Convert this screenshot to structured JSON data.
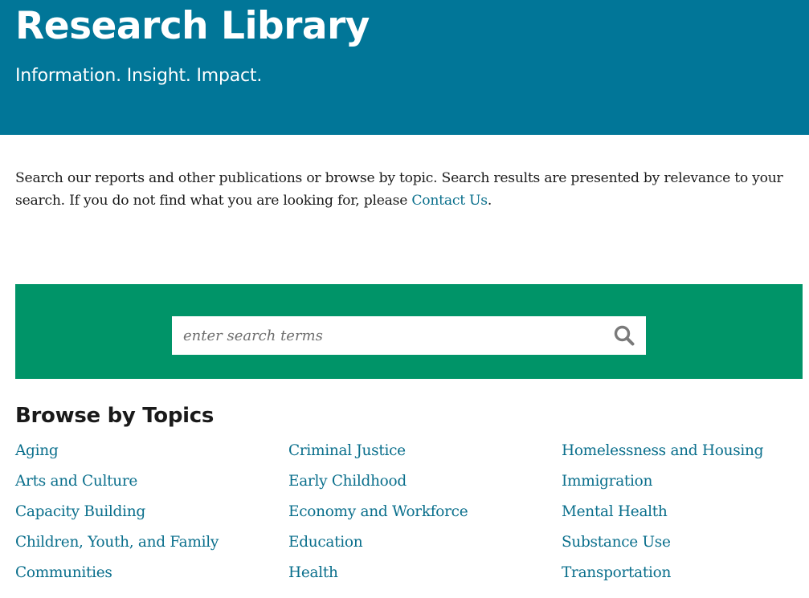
{
  "header": {
    "title": "Research Library",
    "tagline": "Information. Insight. Impact."
  },
  "intro": {
    "text": "Search our reports and other publications or browse by topic. Search results are presented by relevance to your search. If you do not find what you are looking for, please ",
    "link_text": "Contact Us",
    "trailing": "."
  },
  "search": {
    "placeholder": "enter search terms",
    "value": "",
    "button_icon": "search-icon"
  },
  "browse": {
    "title": "Browse by Topics",
    "columns": [
      [
        "Aging",
        "Arts and Culture",
        "Capacity Building",
        "Children, Youth, and Family",
        "Communities"
      ],
      [
        "Criminal Justice",
        "Early Childhood",
        "Economy and Workforce",
        "Education",
        "Health"
      ],
      [
        "Homelessness and Housing",
        "Immigration",
        "Mental Health",
        "Substance Use",
        "Transportation"
      ]
    ]
  },
  "colors": {
    "header_bg": "#017698",
    "search_band_bg": "#009468",
    "link": "#0a6f8c"
  }
}
